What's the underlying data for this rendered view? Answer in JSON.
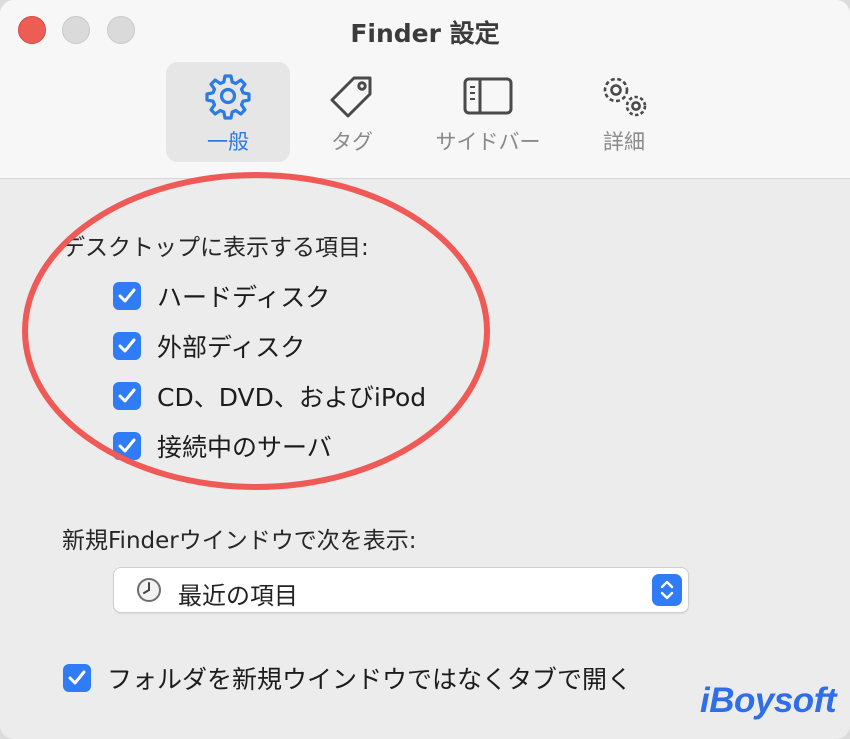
{
  "window": {
    "title": "Finder 設定"
  },
  "tabs": [
    {
      "label": "一般",
      "icon": "gear-icon",
      "active": true
    },
    {
      "label": "タグ",
      "icon": "tag-icon",
      "active": false
    },
    {
      "label": "サイドバー",
      "icon": "sidebar-icon",
      "active": false
    },
    {
      "label": "詳細",
      "icon": "gears-icon",
      "active": false
    }
  ],
  "desktop_section": {
    "label": "デスクトップに表示する項目:",
    "items": [
      {
        "label": "ハードディスク",
        "checked": true
      },
      {
        "label": "外部ディスク",
        "checked": true
      },
      {
        "label": "CD、DVD、およびiPod",
        "checked": true
      },
      {
        "label": "接続中のサーバ",
        "checked": true
      }
    ]
  },
  "new_window": {
    "label": "新規Finderウインドウで次を表示:",
    "value": "最近の項目",
    "icon": "clock-icon"
  },
  "tabs_option": {
    "label": "フォルダを新規ウインドウではなくタブで開く",
    "checked": true
  },
  "watermark": "iBoysoft",
  "colors": {
    "accent": "#2f7cf6",
    "highlight": "#ef5a57",
    "close": "#ee5d54"
  }
}
